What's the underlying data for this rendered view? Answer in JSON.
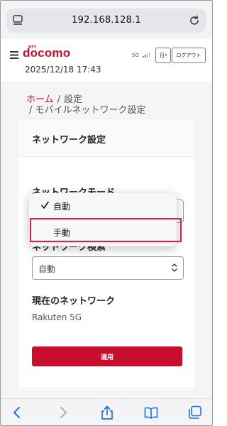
{
  "browser": {
    "url": "192.168.128.1",
    "tabs_icon": "tabs-icon",
    "reload_icon": "reload-icon"
  },
  "header": {
    "logo": "docomo",
    "logo_superscript": "NTT",
    "datetime": "2025/12/18 17:43",
    "network_indicator": "5G",
    "language_button": "日",
    "logout_button": "ログアウト"
  },
  "breadcrumb": {
    "home": "ホーム",
    "separator": "/",
    "settings": "設定",
    "current": "/ モバイルネットワーク設定"
  },
  "card": {
    "title": "ネットワーク設定",
    "network_mode_label": "ネットワークモード",
    "network_search_label": "ネットワーク検索",
    "network_search_value": "自動",
    "current_network_label": "現在のネットワーク",
    "current_network_value": "Rakuten 5G",
    "apply_button": "適用"
  },
  "dropdown": {
    "options": [
      {
        "label": "自動",
        "selected": true
      },
      {
        "label": "手動",
        "selected": false
      }
    ]
  },
  "colors": {
    "brand": "#c8102e",
    "highlight": "#e01e3a",
    "ios_blue": "#1a73e8"
  }
}
